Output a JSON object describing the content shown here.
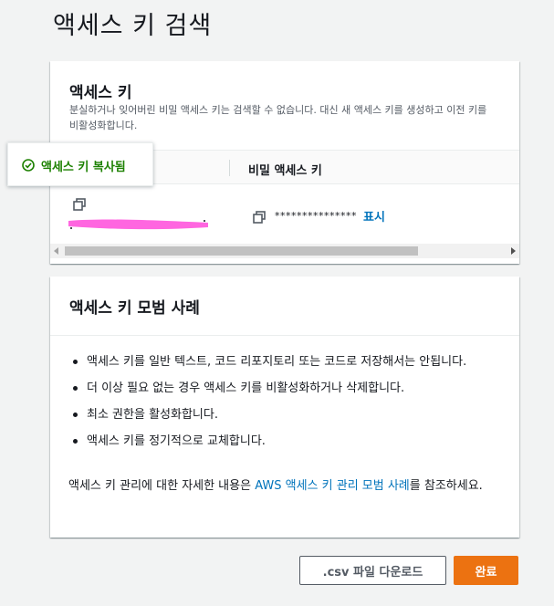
{
  "page": {
    "title": "액세스 키 검색"
  },
  "keys_panel": {
    "title": "액세스 키",
    "description": "분실하거나 잊어버린 비밀 액세스 키는 검색할 수 없습니다. 대신 새 액세스 키를 생성하고 이전 키를 비활성화합니다.",
    "columns": {
      "secret_key": "비밀 액세스 키"
    },
    "row": {
      "secret_masked": "***************",
      "show_label": "표시"
    },
    "tooltip": {
      "text": "액세스 키 복사됨"
    }
  },
  "best_practices_panel": {
    "title": "액세스 키 모범 사례",
    "items": [
      "액세스 키를 일반 텍스트, 코드 리포지토리 또는 코드로 저장해서는 안됩니다.",
      "더 이상 필요 없는 경우 액세스 키를 비활성화하거나 삭제합니다.",
      "최소 권한을 활성화합니다.",
      "액세스 키를 정기적으로 교체합니다."
    ],
    "footer_prefix": "액세스 키 관리에 대한 자세한 내용은 ",
    "footer_link": "AWS 액세스 키 관리 모범 사례",
    "footer_suffix": "를 참조하세요."
  },
  "actions": {
    "download_label": ".csv 파일 다운로드",
    "done_label": "완료"
  },
  "colors": {
    "success": "#1d8102",
    "link": "#0073bb",
    "primary_button": "#ec7211",
    "redaction": "#ff66e0"
  },
  "icons": {
    "copy": "copy-icon",
    "success": "check-circle-icon"
  }
}
